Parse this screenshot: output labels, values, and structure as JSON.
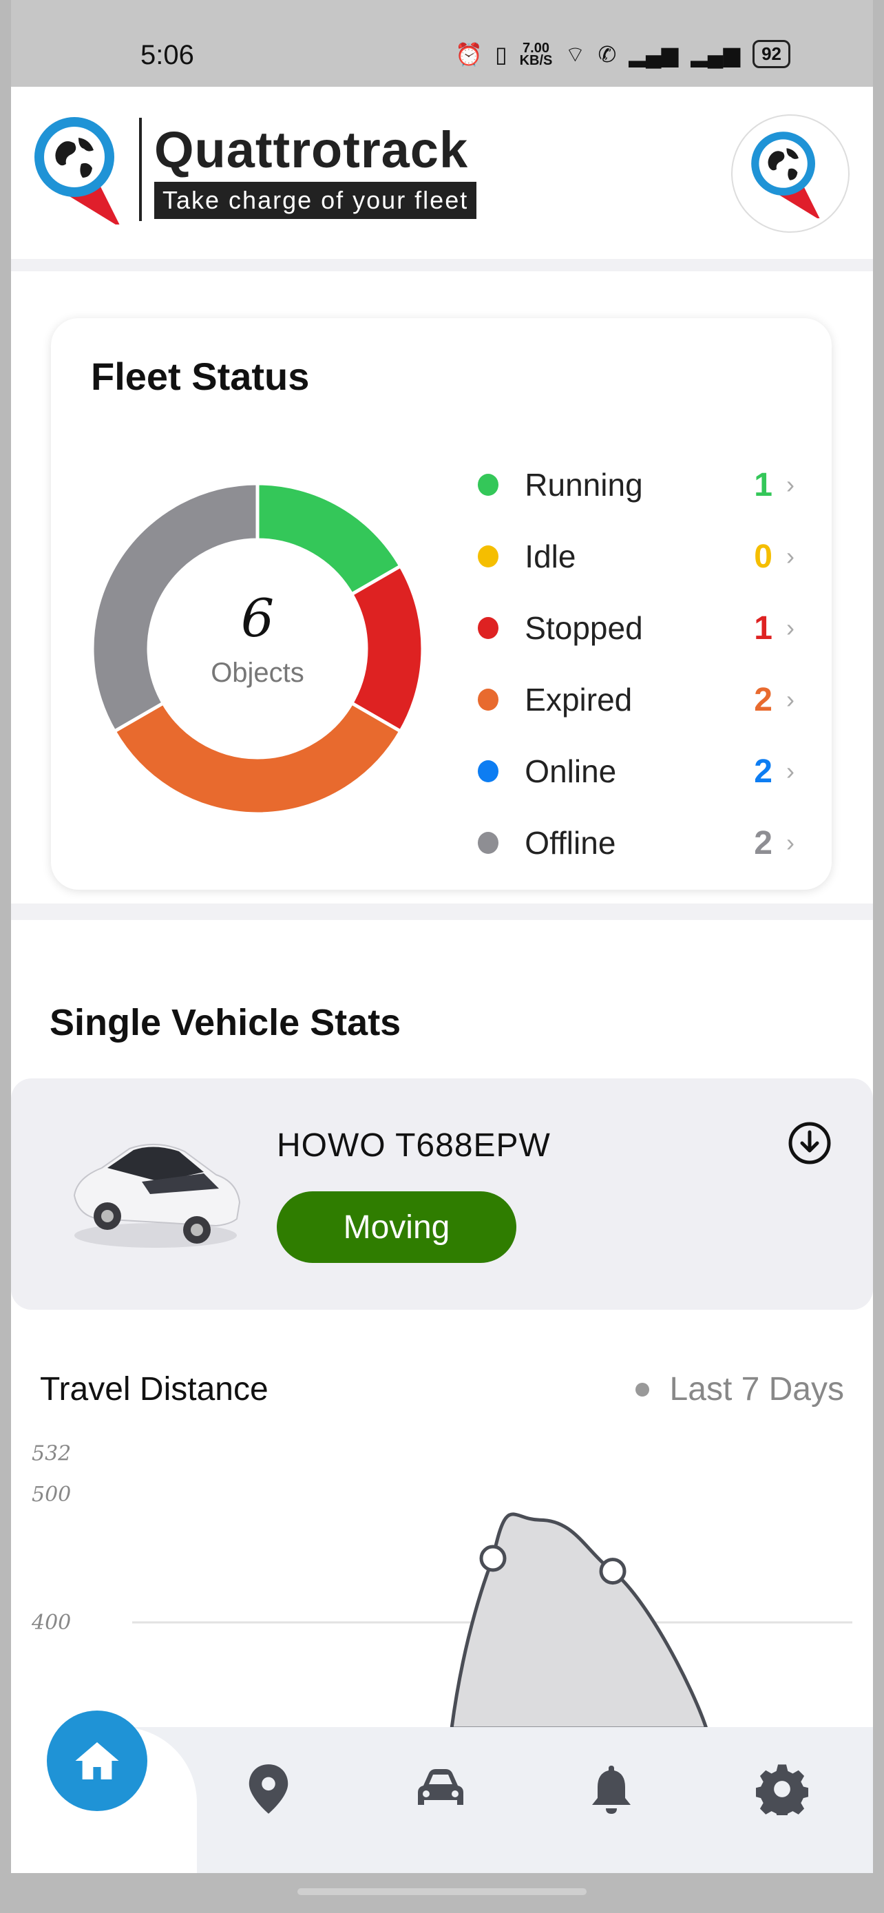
{
  "status_bar": {
    "time": "5:06",
    "speed_value": "7.00",
    "speed_unit": "KB/S",
    "battery": "92"
  },
  "header": {
    "brand_title": "Quattrotrack",
    "brand_tagline": "Take charge of your  fleet"
  },
  "fleet_status": {
    "title": "Fleet Status",
    "total": "6",
    "total_label": "Objects",
    "items": [
      {
        "label": "Running",
        "count": "1",
        "color": "#34c759"
      },
      {
        "label": "Idle",
        "count": "0",
        "color": "#f5be00"
      },
      {
        "label": "Stopped",
        "count": "1",
        "color": "#de2222"
      },
      {
        "label": "Expired",
        "count": "2",
        "color": "#e86a2e"
      },
      {
        "label": "Online",
        "count": "2",
        "color": "#0d7df2"
      },
      {
        "label": "Offline",
        "count": "2",
        "color": "#8e8e93"
      }
    ],
    "chevron": "›",
    "donut_segments": [
      {
        "label": "Running",
        "value": 1,
        "color": "#34c759"
      },
      {
        "label": "Stopped",
        "value": 1,
        "color": "#de2222"
      },
      {
        "label": "Expired",
        "value": 2,
        "color": "#e86a2e"
      },
      {
        "label": "Offline",
        "value": 2,
        "color": "#8e8e93"
      }
    ]
  },
  "single_vehicle": {
    "section_title": "Single Vehicle Stats",
    "vehicle_name": "HOWO T688EPW",
    "status": "Moving",
    "status_color": "#2f7d00"
  },
  "travel_distance": {
    "title": "Travel Distance",
    "range": "Last 7 Days"
  },
  "chart_data": {
    "type": "area",
    "y_ticks": [
      "532",
      "500",
      "400"
    ],
    "yrange_visible": [
      0,
      532
    ],
    "points_visible": [
      {
        "y": 0
      },
      {
        "y": 450
      },
      {
        "y": 480
      },
      {
        "y": 440
      },
      {
        "y": 0
      }
    ],
    "grid": true
  },
  "navbar": {
    "items": [
      "home-icon",
      "location-icon",
      "car-icon",
      "bell-icon",
      "gear-icon"
    ],
    "active": "home-icon",
    "active_color": "#1f93d6",
    "icon_color": "#4a4d55"
  }
}
